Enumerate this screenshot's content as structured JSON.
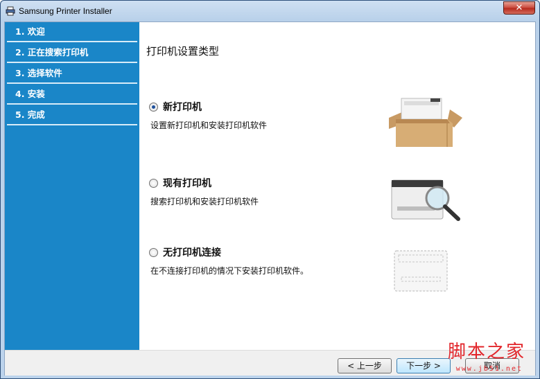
{
  "window": {
    "title": "Samsung Printer Installer",
    "close_label": "✕"
  },
  "sidebar": {
    "items": [
      {
        "label": "1. 欢迎"
      },
      {
        "label": "2. 正在搜索打印机"
      },
      {
        "label": "3. 选择软件"
      },
      {
        "label": "4. 安装"
      },
      {
        "label": "5. 完成"
      }
    ]
  },
  "main": {
    "title": "打印机设置类型",
    "options": [
      {
        "title": "新打印机",
        "description": "设置新打印机和安装打印机软件",
        "selected": true,
        "icon": "printer-in-box-icon"
      },
      {
        "title": "现有打印机",
        "description": "搜索打印机和安装打印机软件",
        "selected": false,
        "icon": "printer-magnifier-icon"
      },
      {
        "title": "无打印机连接",
        "description": "在不连接打印机的情况下安装打印机软件。",
        "selected": false,
        "icon": "printer-outline-icon"
      }
    ]
  },
  "footer": {
    "back_label": "< 上一步",
    "next_label": "下一步 >",
    "cancel_label": "取消"
  },
  "watermark": {
    "text": "脚本之家",
    "subtext": "www.jb51.net"
  },
  "colors": {
    "sidebar": "#1a86c8",
    "watermark": "#e2262b"
  }
}
